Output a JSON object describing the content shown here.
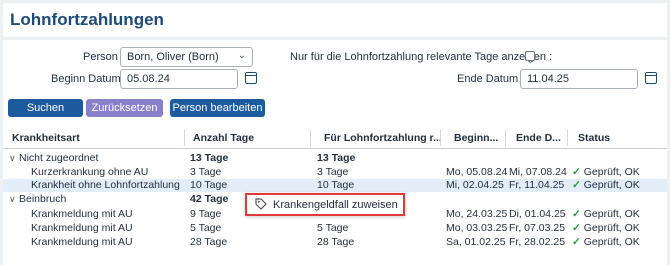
{
  "page": {
    "title": "Lohnfortzahlungen"
  },
  "filters": {
    "person_label": "Person :",
    "person_value": "Born, Oliver (Born)",
    "relevant_only_label": "Nur für die Lohnfortzahlung relevante Tage anzeigen :",
    "relevant_only_checked": false,
    "start_label": "Beginn Datum :",
    "start_value": "05.08.24",
    "end_label": "Ende Datum :",
    "end_value": "11.04.25"
  },
  "buttons": {
    "search": "Suchen",
    "reset": "Zurücksetzen",
    "edit_person": "Person bearbeiten"
  },
  "grid": {
    "columns": [
      "Krankheitsart",
      "Anzahl Tage",
      "Für Lohnfortzahlung r...",
      "Beginn...",
      "Ende D...",
      "Status"
    ],
    "rows": [
      {
        "kind": "group",
        "toggle": "∨",
        "name": "Nicht zugeordnet",
        "days": "13 Tage",
        "relevant": "13 Tage",
        "start": "",
        "end": "",
        "status": ""
      },
      {
        "kind": "item",
        "name": "Kurzerkrankung ohne AU",
        "days": "3 Tage",
        "relevant": "3 Tage",
        "start": "Mo, 05.08.24",
        "end": "Mi, 07.08.24",
        "status": "Geprüft, OK"
      },
      {
        "kind": "item",
        "selected": true,
        "name": "Krankheit ohne Lohnfortzahlung",
        "days": "10 Tage",
        "relevant": "10 Tage",
        "start": "Mi, 02.04.25",
        "end": "Fr, 11.04.25",
        "status": "Geprüft, OK"
      },
      {
        "kind": "group",
        "toggle": "∨",
        "name": "Beinbruch",
        "days": "42 Tage",
        "relevant": "",
        "start": "",
        "end": "",
        "status": ""
      },
      {
        "kind": "item",
        "name": "Krankmeldung mit AU",
        "days": "9 Tage",
        "relevant": "",
        "start": "Mo, 24.03.25",
        "end": "Di, 01.04.25",
        "status": "Geprüft, OK"
      },
      {
        "kind": "item",
        "name": "Krankmeldung mit AU",
        "days": "5 Tage",
        "relevant": "5 Tage",
        "start": "Mo, 03.03.25",
        "end": "Fr, 07.03.25",
        "status": "Geprüft, OK"
      },
      {
        "kind": "item",
        "name": "Krankmeldung mit AU",
        "days": "28 Tage",
        "relevant": "28 Tage",
        "start": "Sa, 01.02.25",
        "end": "Fr, 28.02.25",
        "status": "Geprüft, OK"
      }
    ]
  },
  "context_menu": {
    "item_label": "Krankengeldfall zuweisen",
    "item_icon": "tag-icon"
  },
  "colors": {
    "brand": "#1e4a78",
    "primary_button": "#1e5a9e",
    "secondary_button": "#8a7fc9",
    "ok": "#2e9a3a",
    "highlight_border": "#e03a3a"
  }
}
